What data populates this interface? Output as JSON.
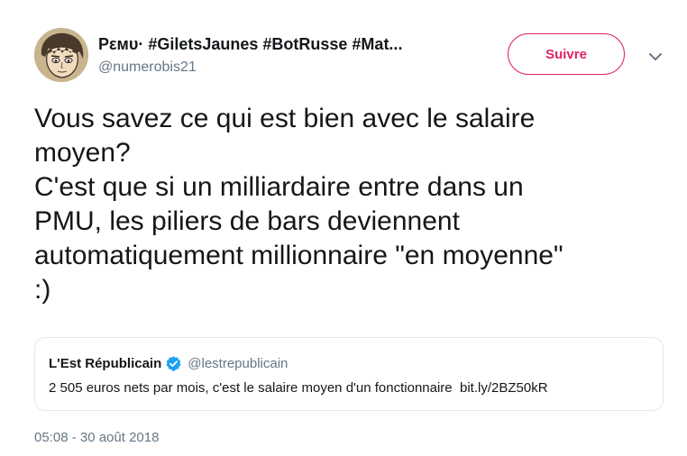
{
  "author": {
    "display_name": "Ρεмυ· #GiletsJaunes #BotRusse #Mat...",
    "handle": "@numerobis21"
  },
  "follow_button": {
    "label": "Suivre",
    "color": "#e0245e"
  },
  "tweet": {
    "text": "Vous savez ce qui est bien avec le salaire\nmoyen?\nC'est que si un milliardaire entre dans un\nPMU, les piliers de bars deviennent\nautomatiquement millionnaire \"en moyenne\"\n:)",
    "timestamp": "05:08 - 30 août 2018"
  },
  "quoted_tweet": {
    "name": "L'Est Républicain",
    "handle": "@lestrepublicain",
    "verified": true,
    "text": "2 505 euros nets par mois, c'est le salaire moyen d'un fonctionnaire",
    "link": "bit.ly/2BZ50kR"
  },
  "icons": {
    "menu": "chevron-down-icon",
    "verified": "verified-badge-icon"
  },
  "colors": {
    "accent": "#e0245e",
    "verified": "#1da1f2",
    "secondary_text": "#657786",
    "border": "#e1e8ed"
  }
}
